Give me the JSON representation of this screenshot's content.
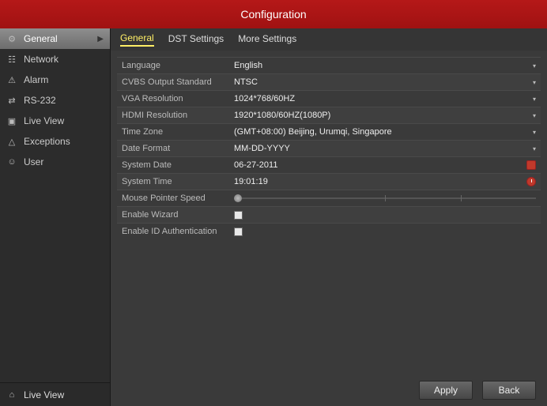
{
  "title": "Configuration",
  "sidebar": {
    "items": [
      {
        "icon": "gear-icon",
        "glyph": "⚙",
        "label": "General",
        "selected": true
      },
      {
        "icon": "network-icon",
        "glyph": "☷",
        "label": "Network"
      },
      {
        "icon": "alarm-icon",
        "glyph": "⚠",
        "label": "Alarm"
      },
      {
        "icon": "serial-icon",
        "glyph": "⇄",
        "label": "RS-232"
      },
      {
        "icon": "liveview-icon",
        "glyph": "▣",
        "label": "Live View"
      },
      {
        "icon": "exceptions-icon",
        "glyph": "△",
        "label": "Exceptions"
      },
      {
        "icon": "user-icon",
        "glyph": "☺",
        "label": "User"
      }
    ],
    "footer": {
      "icon": "home-icon",
      "glyph": "⌂",
      "label": "Live View"
    }
  },
  "tabs": [
    {
      "label": "General",
      "active": true
    },
    {
      "label": "DST Settings"
    },
    {
      "label": "More Settings"
    }
  ],
  "fields": {
    "language": {
      "label": "Language",
      "value": "English",
      "type": "dropdown"
    },
    "cvbs": {
      "label": "CVBS Output Standard",
      "value": "NTSC",
      "type": "dropdown"
    },
    "vga": {
      "label": "VGA Resolution",
      "value": "1024*768/60HZ",
      "type": "dropdown"
    },
    "hdmi": {
      "label": "HDMI Resolution",
      "value": "1920*1080/60HZ(1080P)",
      "type": "dropdown"
    },
    "tz": {
      "label": "Time Zone",
      "value": "(GMT+08:00) Beijing, Urumqi, Singapore",
      "type": "dropdown"
    },
    "datefmt": {
      "label": "Date Format",
      "value": "MM-DD-YYYY",
      "type": "dropdown"
    },
    "sysdate": {
      "label": "System Date",
      "value": "06-27-2011",
      "type": "date"
    },
    "systime": {
      "label": "System Time",
      "value": "19:01:19",
      "type": "time"
    },
    "mouse": {
      "label": "Mouse Pointer Speed",
      "value": "",
      "type": "slider"
    },
    "wizard": {
      "label": "Enable Wizard",
      "value": "",
      "type": "checkbox"
    },
    "idauth": {
      "label": "Enable ID Authentication",
      "value": "",
      "type": "checkbox"
    }
  },
  "buttons": {
    "apply": "Apply",
    "back": "Back"
  }
}
